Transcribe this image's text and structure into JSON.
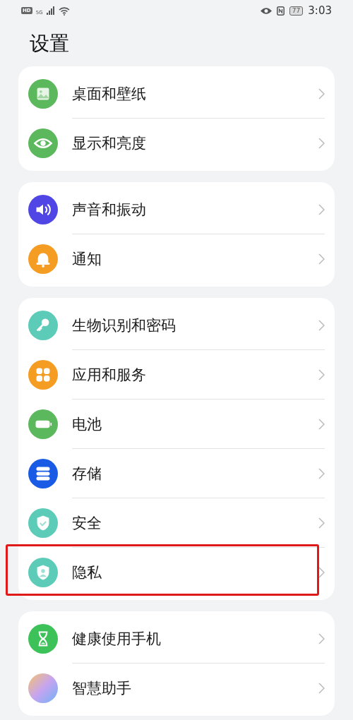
{
  "status_bar": {
    "hd": "HD",
    "network": "5G",
    "battery": "77",
    "time": "3:03"
  },
  "title": "设置",
  "groups": [
    {
      "items": [
        {
          "label": "桌面和壁纸",
          "kind": "image",
          "color": "#5cb85c",
          "highlighted": false
        },
        {
          "label": "显示和亮度",
          "kind": "eye",
          "color": "#5cb85c",
          "highlighted": false
        }
      ]
    },
    {
      "items": [
        {
          "label": "声音和振动",
          "kind": "speaker",
          "color": "#5046e5",
          "highlighted": false
        },
        {
          "label": "通知",
          "kind": "bell",
          "color": "#f59d23",
          "highlighted": false
        }
      ]
    },
    {
      "items": [
        {
          "label": "生物识别和密码",
          "kind": "key",
          "color": "#5ccbb8",
          "highlighted": false
        },
        {
          "label": "应用和服务",
          "kind": "grid",
          "color": "#f59d23",
          "highlighted": false
        },
        {
          "label": "电池",
          "kind": "battery",
          "color": "#5cb85c",
          "highlighted": false
        },
        {
          "label": "存储",
          "kind": "storage",
          "color": "#1a5be6",
          "highlighted": false
        },
        {
          "label": "安全",
          "kind": "shield",
          "color": "#5ccbb8",
          "highlighted": false
        },
        {
          "label": "隐私",
          "kind": "privacy",
          "color": "#5ccbb8",
          "highlighted": true
        }
      ]
    },
    {
      "items": [
        {
          "label": "健康使用手机",
          "kind": "hourglass",
          "color": "#3cc258",
          "highlighted": false
        },
        {
          "label": "智慧助手",
          "kind": "orb",
          "highlighted": false
        }
      ]
    }
  ]
}
